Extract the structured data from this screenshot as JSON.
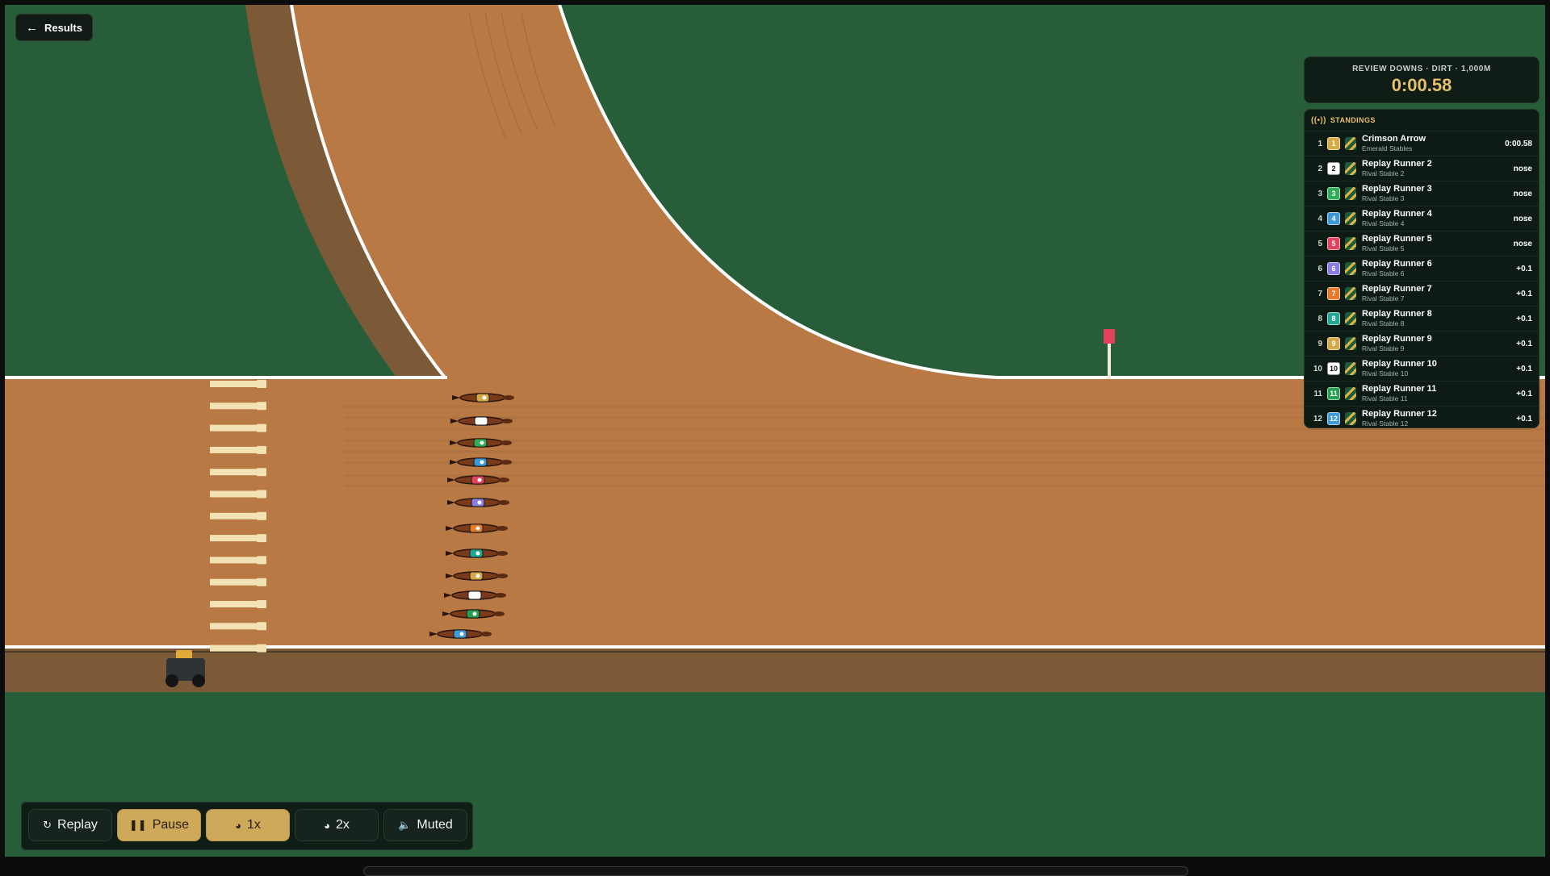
{
  "back_button": {
    "label": "Results",
    "icon": "arrow-left-icon"
  },
  "race": {
    "meta": "REVIEW DOWNS · DIRT · 1,000M",
    "clock": "0:00.58"
  },
  "standings": {
    "title": "STANDINGS",
    "icon": "broadcast-icon",
    "rows": [
      {
        "pos": "1",
        "num": "1",
        "color": "#d8aa45",
        "name": "Crimson Arrow",
        "stable": "Emerald Stables",
        "gap": "0:00.58"
      },
      {
        "pos": "2",
        "num": "2",
        "color": "#ffffff",
        "name": "Replay Runner 2",
        "stable": "Rival Stable 2",
        "gap": "nose"
      },
      {
        "pos": "3",
        "num": "3",
        "color": "#2fae57",
        "name": "Replay Runner 3",
        "stable": "Rival Stable 3",
        "gap": "nose"
      },
      {
        "pos": "4",
        "num": "4",
        "color": "#3a9ad9",
        "name": "Replay Runner 4",
        "stable": "Rival Stable 4",
        "gap": "nose"
      },
      {
        "pos": "5",
        "num": "5",
        "color": "#e2425e",
        "name": "Replay Runner 5",
        "stable": "Rival Stable 5",
        "gap": "nose"
      },
      {
        "pos": "6",
        "num": "6",
        "color": "#8c7be0",
        "name": "Replay Runner 6",
        "stable": "Rival Stable 6",
        "gap": "+0.1"
      },
      {
        "pos": "7",
        "num": "7",
        "color": "#e77a28",
        "name": "Replay Runner 7",
        "stable": "Rival Stable 7",
        "gap": "+0.1"
      },
      {
        "pos": "8",
        "num": "8",
        "color": "#22a693",
        "name": "Replay Runner 8",
        "stable": "Rival Stable 8",
        "gap": "+0.1"
      },
      {
        "pos": "9",
        "num": "9",
        "color": "#d5a94a",
        "name": "Replay Runner 9",
        "stable": "Rival Stable 9",
        "gap": "+0.1"
      },
      {
        "pos": "10",
        "num": "10",
        "color": "#ffffff",
        "name": "Replay Runner 10",
        "stable": "Rival Stable 10",
        "gap": "+0.1"
      },
      {
        "pos": "11",
        "num": "11",
        "color": "#25a04f",
        "name": "Replay Runner 11",
        "stable": "Rival Stable 11",
        "gap": "+0.1"
      },
      {
        "pos": "12",
        "num": "12",
        "color": "#3d9bd8",
        "name": "Replay Runner 12",
        "stable": "Rival Stable 12",
        "gap": "+0.1"
      }
    ]
  },
  "controls": {
    "replay": {
      "label": "Replay",
      "icon": "replay-icon"
    },
    "pause": {
      "label": "Pause",
      "icon": "pause-icon"
    },
    "speed1": {
      "label": "1x",
      "icon": "gauge-icon"
    },
    "speed2": {
      "label": "2x",
      "icon": "gauge-icon"
    },
    "mute": {
      "label": "Muted",
      "icon": "speaker-muted-icon"
    }
  },
  "horse_colors": [
    "#d8aa45",
    "#ffffff",
    "#2fae57",
    "#3a9ad9",
    "#e2425e",
    "#8c7be0",
    "#e77a28",
    "#22a693",
    "#d5a94a",
    "#ffffff",
    "#25a04f",
    "#3d9bd8"
  ],
  "colors": {
    "grass": "#275e39",
    "dirt": "#b87945",
    "dark_dirt": "#7d5a37",
    "gold": "#cfa95a",
    "post_flag": "#e2425e"
  }
}
